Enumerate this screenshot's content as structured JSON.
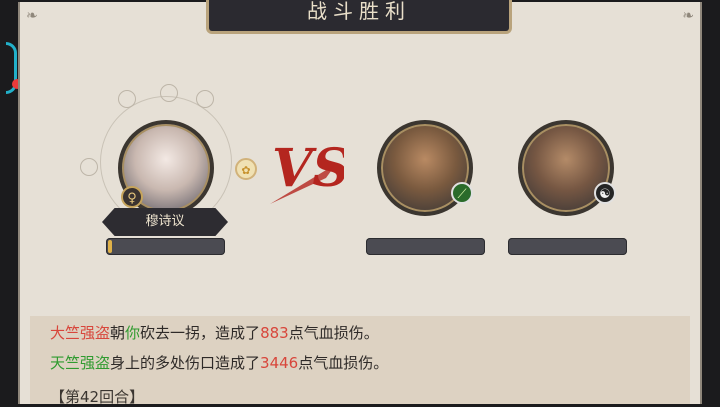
{
  "title": "战斗胜利",
  "hero": {
    "name": "穆诗议",
    "gender_symbol": "♀",
    "extra_symbol": "✿"
  },
  "enemies": [
    {
      "badge_symbol": "⟋"
    },
    {
      "badge_symbol": "☯"
    }
  ],
  "vs_text": "VS",
  "log": {
    "line1": {
      "actor": "大竺强盗",
      "middle": "朝",
      "target": "你",
      "rest1": "砍去一拐，造成了",
      "value": "883",
      "rest2": "点气血损伤。"
    },
    "line2": {
      "actor": "天竺强盗",
      "rest1": "身上的多处伤口造成了",
      "value": "3446",
      "rest2": "点气血损伤。"
    },
    "line3": {
      "text": "【第42回合】"
    }
  },
  "colors": {
    "damage": "#d8463b",
    "name": "#2f9b2f",
    "accent": "#22b0c9"
  }
}
